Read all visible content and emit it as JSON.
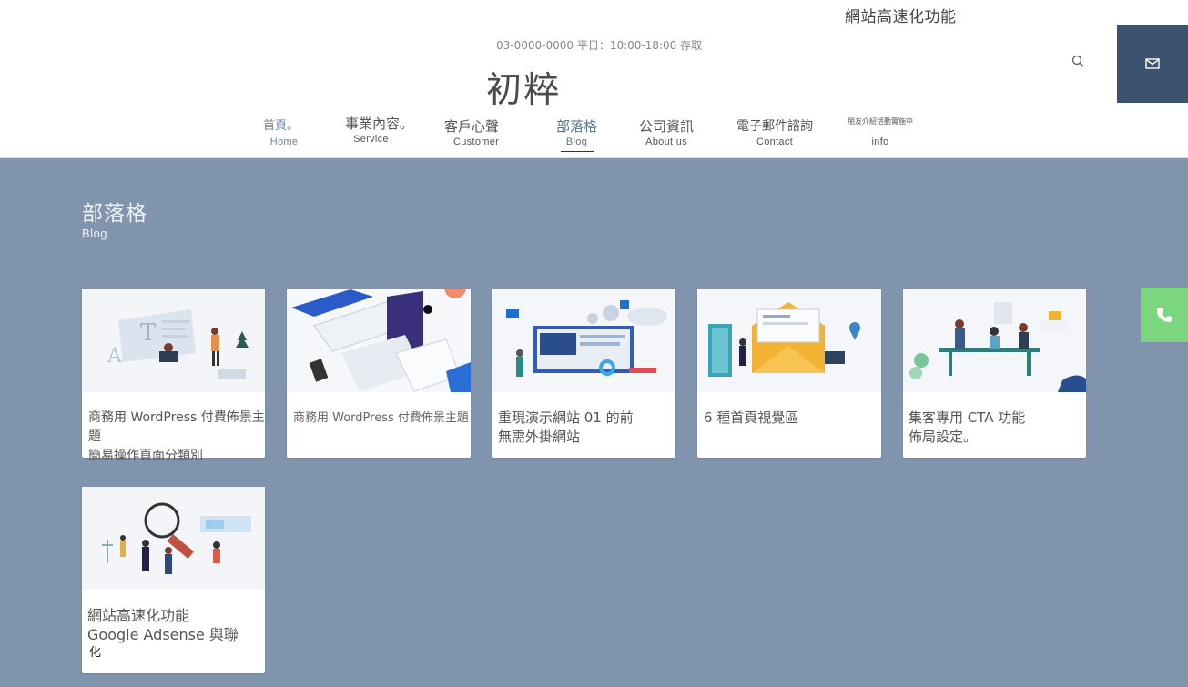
{
  "header": {
    "top_banner": "網站高速化功能",
    "contact_line": "03-0000-0000 平日：10:00-18:00 存取",
    "logo": "初粹"
  },
  "icons": {
    "search": "search-icon",
    "mail": "mail-icon",
    "phone": "phone-icon"
  },
  "nav": [
    {
      "zh": "首頁。",
      "en": "Home"
    },
    {
      "zh": "事業內容。",
      "en": "Service"
    },
    {
      "zh": "客戶心聲",
      "en": "Customer"
    },
    {
      "zh": "部落格",
      "en": "Blog"
    },
    {
      "zh": "公司資訊",
      "en": "About us"
    },
    {
      "zh": "電子郵件諮詢",
      "en": "Contact"
    },
    {
      "zh": "朋友介紹活動實施中",
      "en": "info"
    }
  ],
  "page": {
    "title_zh": "部落格",
    "title_en": "Blog"
  },
  "cards": [
    {
      "title": "商務用 WordPress 付費佈景主題\n簡易操作頁面分類別"
    },
    {
      "title": "商務用 WordPress 付費佈景主題"
    },
    {
      "title": "重現演示網站 01 的前\n無需外掛網站"
    },
    {
      "title": "6 種首頁視覺區"
    },
    {
      "title": " 集客專用 CTA 功能\n佈局設定。"
    },
    {
      "title": "網站高速化功能\nGoogle Adsense 與聯",
      "extra": "化"
    }
  ],
  "colors": {
    "background": "#8095ad",
    "mail_button": "#3c5370",
    "phone_button": "#7bd67f",
    "active_nav": "#5b7593"
  }
}
